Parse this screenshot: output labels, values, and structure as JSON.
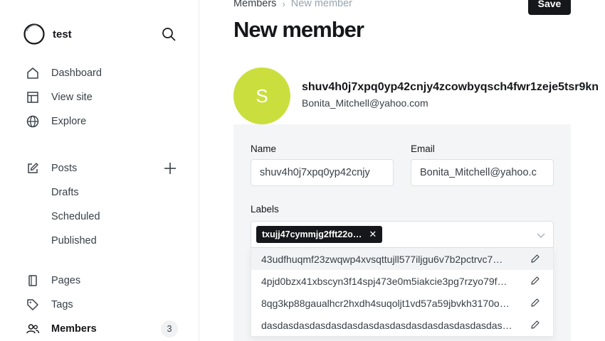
{
  "site": {
    "name": "test"
  },
  "nav": {
    "dashboard": "Dashboard",
    "view_site": "View site",
    "explore": "Explore",
    "posts": "Posts",
    "drafts": "Drafts",
    "scheduled": "Scheduled",
    "published": "Published",
    "pages": "Pages",
    "tags": "Tags",
    "members": "Members",
    "members_count": "3"
  },
  "breadcrumb": {
    "parent": "Members",
    "separator": "›",
    "current": "New member"
  },
  "page": {
    "title": "New member",
    "save_label": "Save"
  },
  "member": {
    "avatar_initial": "S",
    "name": "shuv4h0j7xpq0yp42cnjy4zcowbyqsch4fwr1zeje5tsr9kn",
    "email": "Bonita_Mitchell@yahoo.com"
  },
  "form": {
    "name_label": "Name",
    "name_value": "shuv4h0j7xpq0yp42cnjy",
    "email_label": "Email",
    "email_value": "Bonita_Mitchell@yahoo.c",
    "labels_label": "Labels",
    "selected_label": "txujj47cymmjg2fft22o…",
    "label_options": [
      "43udfhuqmf23zwqwp4xvsqttujll577iljgu6v7b2pctrvc7…",
      "4pjd0bzx41xbscyn3f14spj473e0m5iakcie3pg7rzyo79f…",
      "8qg3kp88gaualhcr2hxdh4suqoljt1vd57a59jbvkh3170o…",
      "dasdasdasdasdasdasdasdasdasdasdasdasdasdasdas…"
    ]
  },
  "colors": {
    "avatar_bg": "#cadf3e",
    "primary_button": "#15171a",
    "card_bg": "#f4f5f6"
  },
  "icons": {
    "logo": "circle-logo-icon",
    "search": "search-icon",
    "dashboard": "home-icon",
    "view_site": "layout-icon",
    "explore": "globe-icon",
    "posts": "edit-icon",
    "add_post": "plus-icon",
    "pages": "page-icon",
    "tags": "tag-icon",
    "members": "members-icon",
    "remove_label": "close-icon",
    "labels_dropdown": "chevron-down-icon",
    "edit_label": "pencil-icon"
  }
}
